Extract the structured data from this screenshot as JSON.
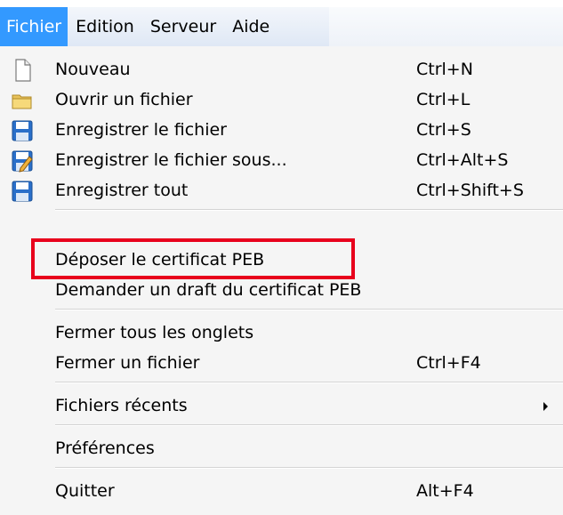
{
  "menubar": {
    "items": [
      {
        "label": "Fichier",
        "active": true
      },
      {
        "label": "Edition",
        "active": false
      },
      {
        "label": "Serveur",
        "active": false
      },
      {
        "label": "Aide",
        "active": false
      }
    ]
  },
  "menu": {
    "items": [
      {
        "label": "Nouveau",
        "shortcut": "Ctrl+N",
        "icon": "new-file-icon"
      },
      {
        "label": "Ouvrir un fichier",
        "shortcut": "Ctrl+L",
        "icon": "open-folder-icon"
      },
      {
        "label": "Enregistrer le fichier",
        "shortcut": "Ctrl+S",
        "icon": "save-icon"
      },
      {
        "label": "Enregistrer le fichier sous...",
        "shortcut": "Ctrl+Alt+S",
        "icon": "save-as-icon"
      },
      {
        "label": "Enregistrer tout",
        "shortcut": "Ctrl+Shift+S",
        "icon": "save-all-icon"
      },
      {
        "label": "Déposer le certificat PEB",
        "shortcut": "",
        "highlighted": true
      },
      {
        "label": "Demander un draft du certificat PEB",
        "shortcut": ""
      },
      {
        "label": "Fermer tous les onglets",
        "shortcut": ""
      },
      {
        "label": "Fermer un fichier",
        "shortcut": "Ctrl+F4"
      },
      {
        "label": "Fichiers récents",
        "shortcut": "",
        "submenu": true
      },
      {
        "label": "Préférences",
        "shortcut": ""
      },
      {
        "label": "Quitter",
        "shortcut": "Alt+F4"
      }
    ]
  },
  "colors": {
    "active_menu": "#3399ff",
    "highlight_border": "#e8001c",
    "panel_background": "#f5f5f5"
  }
}
